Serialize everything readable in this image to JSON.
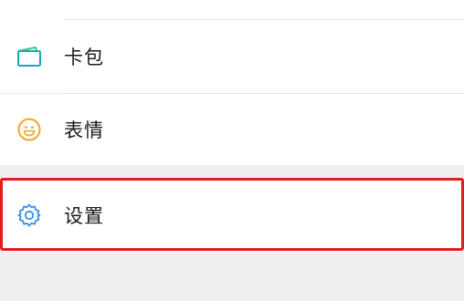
{
  "menu": {
    "items": [
      {
        "label": "卡包",
        "icon": "card-wallet-icon"
      },
      {
        "label": "表情",
        "icon": "smiley-icon"
      },
      {
        "label": "设置",
        "icon": "gear-icon"
      }
    ]
  },
  "colors": {
    "highlight": "#e31c1c",
    "icon_teal": "#19a7b8",
    "icon_green": "#3cc47c",
    "icon_orange": "#f5a623",
    "icon_blue": "#3a8ee6"
  }
}
